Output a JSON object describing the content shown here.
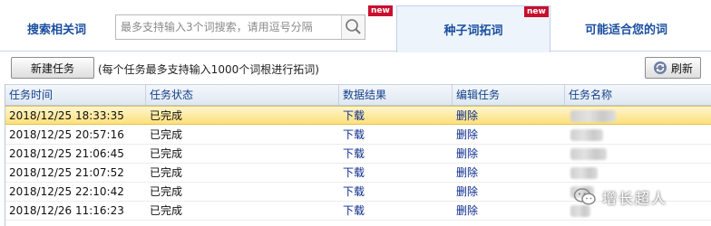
{
  "topbar": {
    "search_tab_label": "搜索相关词",
    "search_placeholder": "最多支持输入3个词搜索，请用逗号分隔",
    "search_new_badge": "new",
    "seed_tab_label": "种子词拓词",
    "seed_new_badge": "new",
    "suggest_tab_label": "可能适合您的词"
  },
  "toolbar": {
    "new_task_label": "新建任务",
    "hint": "(每个任务最多支持输入1000个词根进行拓词)",
    "refresh_label": "刷新"
  },
  "table": {
    "headers": [
      "任务时间",
      "任务状态",
      "数据结果",
      "编辑任务",
      "任务名称"
    ],
    "rows": [
      {
        "time": "2018/12/25 18:33:35",
        "status": "已完成",
        "result": "下载",
        "edit": "删除",
        "selected": true
      },
      {
        "time": "2018/12/25 20:57:16",
        "status": "已完成",
        "result": "下载",
        "edit": "删除"
      },
      {
        "time": "2018/12/25 21:06:45",
        "status": "已完成",
        "result": "下载",
        "edit": "删除"
      },
      {
        "time": "2018/12/25 21:07:52",
        "status": "已完成",
        "result": "下载",
        "edit": "删除"
      },
      {
        "time": "2018/12/25 22:10:42",
        "status": "已完成",
        "result": "下载",
        "edit": "删除"
      },
      {
        "time": "2018/12/26 11:16:23",
        "status": "已完成",
        "result": "下载",
        "edit": "删除"
      }
    ]
  },
  "watermark": {
    "text": "增长超人",
    "icon": "wechat-icon"
  },
  "colors": {
    "accent": "#1a4fa0",
    "link": "#0a2a8c",
    "selected_row": "#fbe07a",
    "new_badge": "#c8102e"
  }
}
